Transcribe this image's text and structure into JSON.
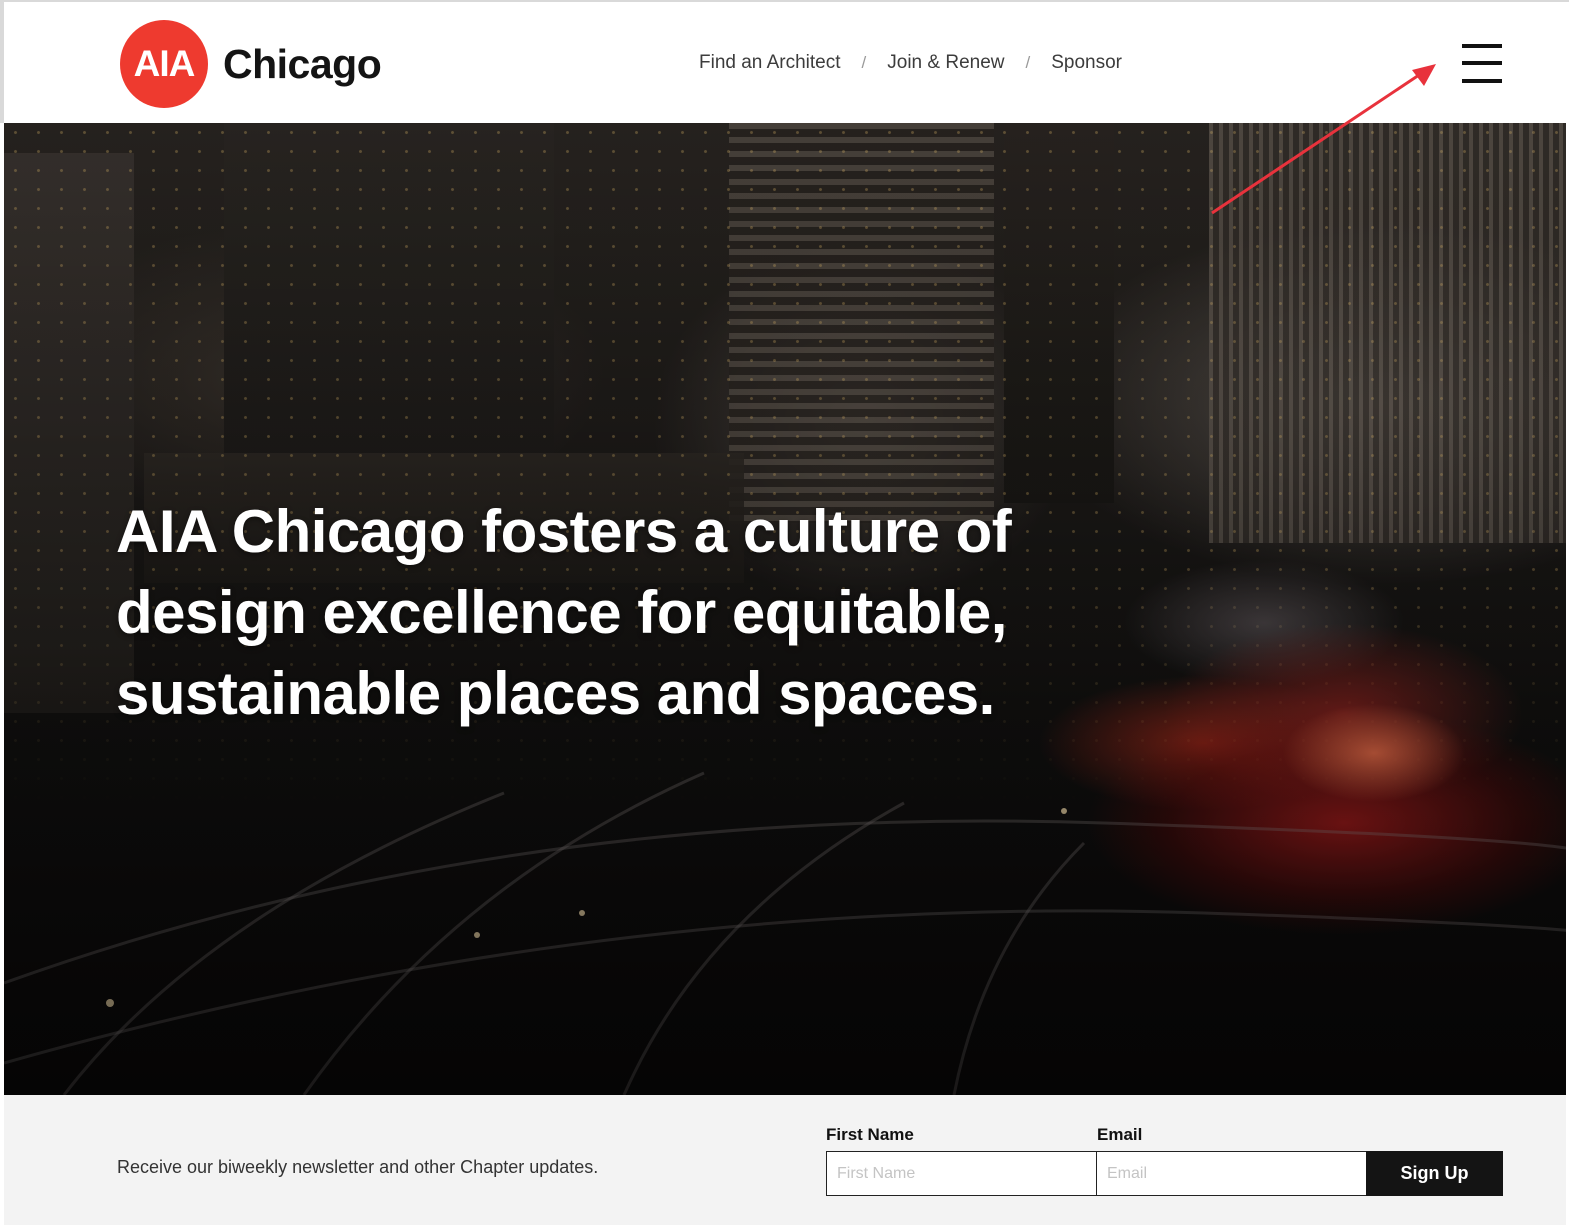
{
  "header": {
    "logo_badge": "AIA",
    "logo_word": "Chicago",
    "nav": [
      {
        "label": "Find an Architect"
      },
      {
        "label": "Join & Renew"
      },
      {
        "label": "Sponsor"
      }
    ],
    "nav_separator": "/",
    "menu_icon": "hamburger-menu-icon"
  },
  "hero": {
    "headline": "AIA Chicago fosters a culture of design excellence for equitable, sustainable places and spaces."
  },
  "newsletter": {
    "text": "Receive our biweekly newsletter and other Chapter updates.",
    "first_name_label": "First Name",
    "first_name_placeholder": "First Name",
    "email_label": "Email",
    "email_placeholder": "Email",
    "submit_label": "Sign Up"
  },
  "colors": {
    "brand_red": "#ee3a2f",
    "annotation_arrow": "#e8323c",
    "button_bg": "#141414"
  }
}
